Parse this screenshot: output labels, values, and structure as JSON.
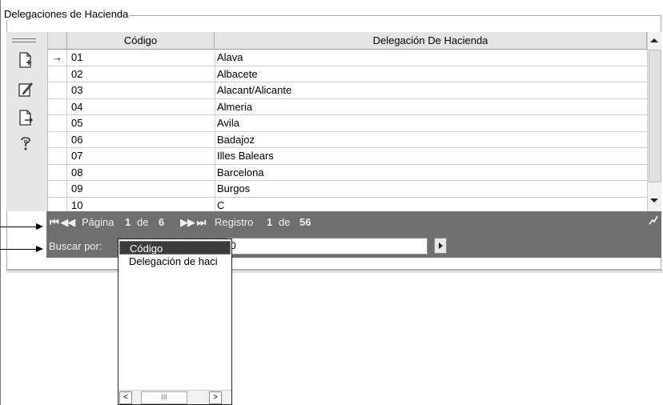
{
  "panel": {
    "title": "Delegaciones de Hacienda"
  },
  "toolbar": {
    "icons": [
      "handle-icon",
      "new-record-icon",
      "edit-record-icon",
      "export-record-icon",
      "help-icon"
    ]
  },
  "grid": {
    "columns": [
      "Código",
      "Delegación De Hacienda"
    ],
    "current_row_marker": "→",
    "rows": [
      {
        "codigo": "01",
        "delegacion": "Alava"
      },
      {
        "codigo": "02",
        "delegacion": "Albacete"
      },
      {
        "codigo": "03",
        "delegacion": "Alacant/Alicante"
      },
      {
        "codigo": "04",
        "delegacion": "Almeria"
      },
      {
        "codigo": "05",
        "delegacion": "Avila"
      },
      {
        "codigo": "06",
        "delegacion": "Badajoz"
      },
      {
        "codigo": "07",
        "delegacion": "Illes Balears"
      },
      {
        "codigo": "08",
        "delegacion": "Barcelona"
      },
      {
        "codigo": "09",
        "delegacion": "Burgos"
      },
      {
        "codigo": "10",
        "delegacion": "C"
      }
    ]
  },
  "pager": {
    "first_prev": "⏮ ◀◀",
    "page_label": "Página",
    "page_current": "1",
    "of": "de",
    "page_total": "6",
    "next_last": "▶▶ ⏭",
    "record_label": "Registro",
    "record_current": "1",
    "record_total": "56"
  },
  "search": {
    "label": "Buscar por:",
    "value": "0",
    "options": [
      "Código",
      "Delegación de haci"
    ],
    "selected": "Código",
    "scroll_left": "<",
    "scroll_thumb": "III",
    "scroll_right": ">"
  }
}
